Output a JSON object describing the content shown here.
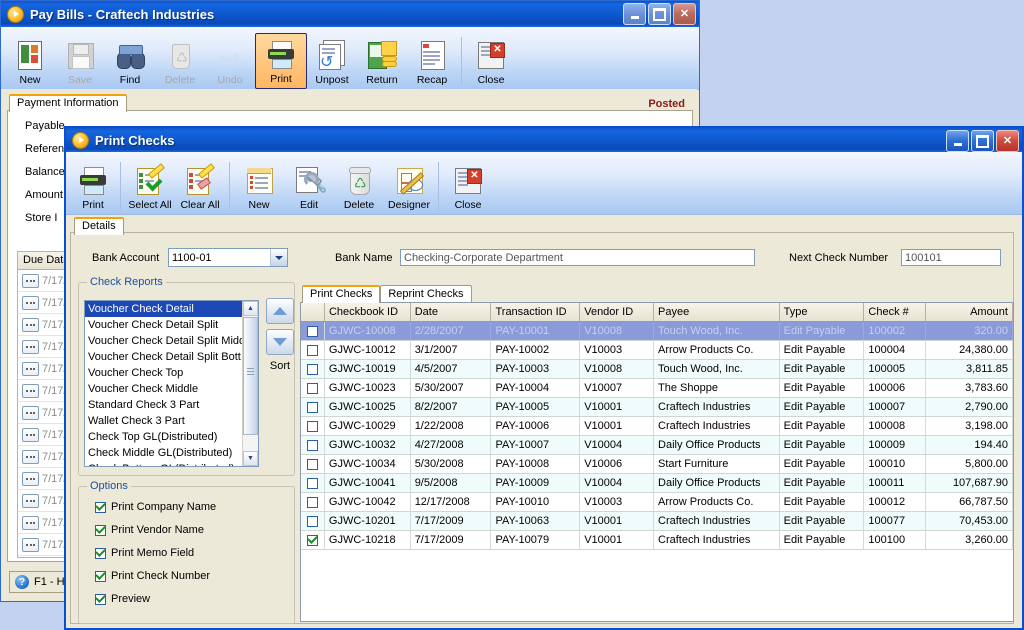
{
  "desktop": {
    "bg": "#c3d2ef"
  },
  "pay_bills_window": {
    "title": "Pay Bills - Craftech Industries",
    "icon": "app-orb-icon",
    "window_buttons": [
      "minimize",
      "maximize",
      "close"
    ],
    "toolbar": [
      {
        "label": "New",
        "icon": "new-document-icon",
        "enabled": true,
        "selected": false
      },
      {
        "label": "Save",
        "icon": "save-floppy-icon",
        "enabled": false,
        "selected": false
      },
      {
        "label": "Find",
        "icon": "binoculars-icon",
        "enabled": true,
        "selected": false
      },
      {
        "label": "Delete",
        "icon": "recycle-bin-icon",
        "enabled": false,
        "selected": false
      },
      {
        "label": "Undo",
        "icon": "undo-arrow-icon",
        "enabled": false,
        "selected": false
      },
      {
        "label": "Print",
        "icon": "printer-icon",
        "enabled": true,
        "selected": true
      },
      {
        "label": "Unpost",
        "icon": "unpost-icon",
        "enabled": true,
        "selected": false
      },
      {
        "label": "Return",
        "icon": "return-money-icon",
        "enabled": true,
        "selected": false
      },
      {
        "label": "Recap",
        "icon": "recap-report-icon",
        "enabled": true,
        "selected": false
      },
      {
        "label": "Close",
        "icon": "close-document-icon",
        "enabled": true,
        "selected": false
      }
    ],
    "tab": "Payment Information",
    "status_right": "Posted",
    "fields": [
      {
        "label": "Payable"
      },
      {
        "label": "Referen"
      },
      {
        "label": "Balance"
      },
      {
        "label": "Amount"
      },
      {
        "label": "Store I"
      }
    ],
    "grid": {
      "column_header": "Due Date",
      "rows": [
        "7/17/",
        "7/17/",
        "7/17/",
        "7/17/",
        "7/17/",
        "7/17/",
        "7/17/",
        "7/17/",
        "7/17/",
        "7/17/",
        "7/17/",
        "7/17/",
        "7/17/"
      ]
    },
    "statusbar": {
      "icon": "help-icon",
      "text": "F1 - H"
    }
  },
  "print_checks_window": {
    "title": "Print Checks",
    "icon": "app-orb-icon",
    "window_buttons": [
      "minimize",
      "maximize",
      "close"
    ],
    "toolbar": [
      {
        "label": "Print",
        "icon": "printer-icon"
      },
      {
        "label": "Select All",
        "icon": "clipboard-check-icon"
      },
      {
        "label": "Clear All",
        "icon": "clipboard-erase-icon"
      },
      {
        "label": "New",
        "icon": "new-list-icon"
      },
      {
        "label": "Edit",
        "icon": "wrench-edit-icon"
      },
      {
        "label": "Delete",
        "icon": "recycle-bin-icon"
      },
      {
        "label": "Designer",
        "icon": "designer-pencil-icon"
      },
      {
        "label": "Close",
        "icon": "close-document-icon"
      }
    ],
    "outer_tabs": [
      {
        "label": "Details",
        "active": true
      }
    ],
    "form": {
      "bank_account_label": "Bank Account",
      "bank_account_value": "1100-01",
      "bank_name_label": "Bank Name",
      "bank_name_value": "Checking-Corporate Department",
      "next_check_number_label": "Next Check Number",
      "next_check_number_value": "100101"
    },
    "check_reports": {
      "caption": "Check Reports",
      "items": [
        {
          "label": "Voucher Check Detail",
          "selected": true
        },
        {
          "label": "Voucher Check Detail Split",
          "selected": false
        },
        {
          "label": "Voucher Check Detail Split Midd",
          "selected": false
        },
        {
          "label": "Voucher Check Detail Split Bott",
          "selected": false
        },
        {
          "label": "Voucher Check Top",
          "selected": false
        },
        {
          "label": "Voucher Check Middle",
          "selected": false
        },
        {
          "label": "Standard Check 3 Part",
          "selected": false
        },
        {
          "label": "Wallet Check 3 Part",
          "selected": false
        },
        {
          "label": "Check Top GL(Distributed)",
          "selected": false
        },
        {
          "label": "Check Middle GL(Distributed)",
          "selected": false
        },
        {
          "label": "Check Bottom GL(Distributed)",
          "selected": false
        }
      ],
      "sort_label": "Sort",
      "sort_up_icon": "triangle-up-icon",
      "sort_down_icon": "triangle-down-icon"
    },
    "options": {
      "caption": "Options",
      "items": [
        {
          "label": "Print Company Name",
          "checked": true
        },
        {
          "label": "Print Vendor Name",
          "checked": true
        },
        {
          "label": "Print Memo Field",
          "checked": true
        },
        {
          "label": "Print Check Number",
          "checked": true
        },
        {
          "label": "Preview",
          "checked": true
        }
      ]
    },
    "inner_tabs": [
      {
        "label": "Print Checks",
        "active": true
      },
      {
        "label": "Reprint Checks",
        "active": false
      }
    ],
    "checks_grid": {
      "columns": [
        "Checkbook ID",
        "Date",
        "Transaction ID",
        "Vendor ID",
        "Payee",
        "Type",
        "Check #",
        "Amount"
      ],
      "rows": [
        {
          "checked": false,
          "selected": true,
          "cells": [
            "GJWC-10008",
            "2/28/2007",
            "PAY-10001",
            "V10008",
            "Touch Wood, Inc.",
            "Edit Payable",
            "100002",
            "320.00"
          ]
        },
        {
          "checked": false,
          "selected": false,
          "cells": [
            "GJWC-10012",
            "3/1/2007",
            "PAY-10002",
            "V10003",
            "Arrow Products Co.",
            "Edit Payable",
            "100004",
            "24,380.00"
          ]
        },
        {
          "checked": false,
          "selected": false,
          "cells": [
            "GJWC-10019",
            "4/5/2007",
            "PAY-10003",
            "V10008",
            "Touch Wood, Inc.",
            "Edit Payable",
            "100005",
            "3,811.85"
          ]
        },
        {
          "checked": false,
          "selected": false,
          "cells": [
            "GJWC-10023",
            "5/30/2007",
            "PAY-10004",
            "V10007",
            "The Shoppe",
            "Edit Payable",
            "100006",
            "3,783.60"
          ]
        },
        {
          "checked": false,
          "selected": false,
          "cells": [
            "GJWC-10025",
            "8/2/2007",
            "PAY-10005",
            "V10001",
            "Craftech Industries",
            "Edit Payable",
            "100007",
            "2,790.00"
          ]
        },
        {
          "checked": false,
          "selected": false,
          "cells": [
            "GJWC-10029",
            "1/22/2008",
            "PAY-10006",
            "V10001",
            "Craftech Industries",
            "Edit Payable",
            "100008",
            "3,198.00"
          ]
        },
        {
          "checked": false,
          "selected": false,
          "cells": [
            "GJWC-10032",
            "4/27/2008",
            "PAY-10007",
            "V10004",
            "Daily Office Products",
            "Edit Payable",
            "100009",
            "194.40"
          ]
        },
        {
          "checked": false,
          "selected": false,
          "cells": [
            "GJWC-10034",
            "5/30/2008",
            "PAY-10008",
            "V10006",
            "Start Furniture",
            "Edit Payable",
            "100010",
            "5,800.00"
          ]
        },
        {
          "checked": false,
          "selected": false,
          "cells": [
            "GJWC-10041",
            "9/5/2008",
            "PAY-10009",
            "V10004",
            "Daily Office Products",
            "Edit Payable",
            "100011",
            "107,687.90"
          ]
        },
        {
          "checked": false,
          "selected": false,
          "cells": [
            "GJWC-10042",
            "12/17/2008",
            "PAY-10010",
            "V10003",
            "Arrow Products Co.",
            "Edit Payable",
            "100012",
            "66,787.50"
          ]
        },
        {
          "checked": false,
          "selected": false,
          "cells": [
            "GJWC-10201",
            "7/17/2009",
            "PAY-10063",
            "V10001",
            "Craftech Industries",
            "Edit Payable",
            "100077",
            "70,453.00"
          ]
        },
        {
          "checked": true,
          "selected": false,
          "cells": [
            "GJWC-10218",
            "7/17/2009",
            "PAY-10079",
            "V10001",
            "Craftech Industries",
            "Edit Payable",
            "100100",
            "3,260.00"
          ]
        }
      ]
    }
  }
}
